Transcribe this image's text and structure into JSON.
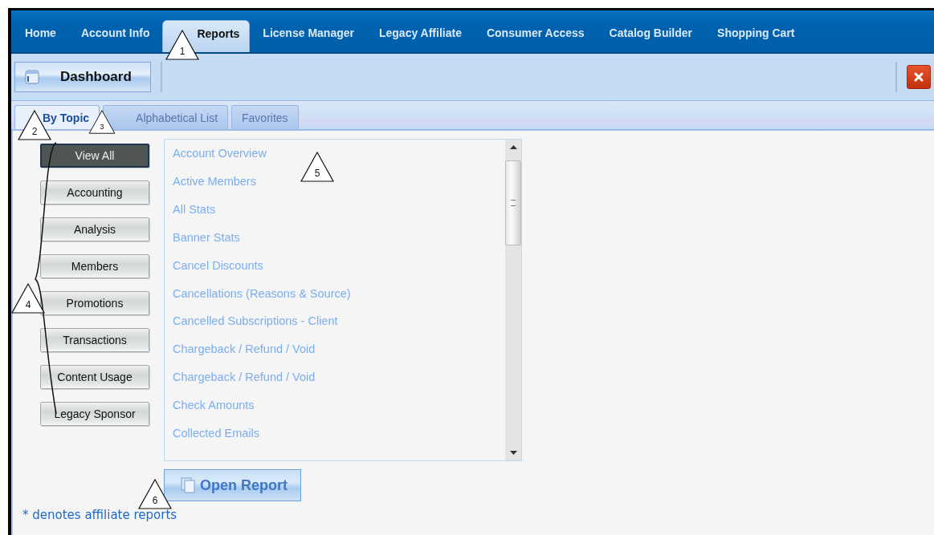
{
  "nav": {
    "items": [
      {
        "label": "Home",
        "selected": false
      },
      {
        "label": "Account Info",
        "selected": false
      },
      {
        "label": "Reports",
        "selected": true
      },
      {
        "label": "License Manager",
        "selected": false
      },
      {
        "label": "Legacy Affiliate",
        "selected": false
      },
      {
        "label": "Consumer Access",
        "selected": false
      },
      {
        "label": "Catalog Builder",
        "selected": false
      },
      {
        "label": "Shopping Cart",
        "selected": false
      }
    ]
  },
  "toolbar": {
    "dashboard_button": "Dashboard"
  },
  "tabs": [
    {
      "label": "By Topic",
      "selected": true
    },
    {
      "label": "Alphabetical List",
      "selected": false
    },
    {
      "label": "Favorites",
      "selected": false
    }
  ],
  "categories": [
    {
      "label": "View All",
      "selected": true
    },
    {
      "label": "Accounting",
      "selected": false
    },
    {
      "label": "Analysis",
      "selected": false
    },
    {
      "label": "Members",
      "selected": false
    },
    {
      "label": "Promotions",
      "selected": false
    },
    {
      "label": "Transactions",
      "selected": false
    },
    {
      "label": "Content Usage",
      "selected": false
    },
    {
      "label": "Legacy Sponsor",
      "selected": false
    }
  ],
  "reports": [
    "Account Overview",
    "Active Members",
    "All Stats",
    "Banner Stats",
    "Cancel Discounts",
    "Cancellations (Reasons & Source)",
    "Cancelled Subscriptions - Client",
    "Chargeback / Refund / Void",
    "Chargeback / Refund / Void",
    "Check Amounts",
    "Collected Emails"
  ],
  "open_report_button": "Open Report",
  "footnote": "* denotes affiliate reports",
  "callouts": [
    "1",
    "2",
    "3",
    "4",
    "5",
    "6"
  ]
}
